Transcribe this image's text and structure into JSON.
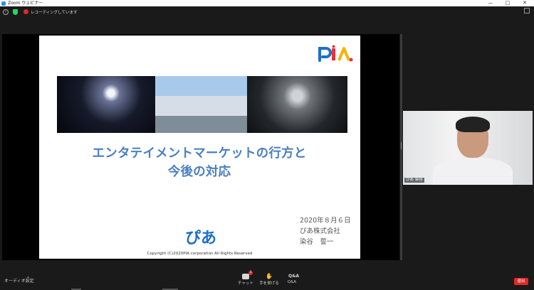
{
  "window": {
    "app_title": "Zoom ウェビナー",
    "minimize": "—",
    "maximize": "□",
    "close": "✕"
  },
  "topbar": {
    "info_icon": "i",
    "recording_text": "レコーディングしています"
  },
  "slide": {
    "title_line1": "エンタテイメントマーケットの行方と",
    "title_line2": "今後の対応",
    "date": "2020年８月６日",
    "company": "ぴあ株式会社",
    "presenter": "染谷　誓一",
    "copyright": "Copyright (C)2020PIA corporation All Rights Reserved",
    "logo_pia": "PIA",
    "logo_hira": "ぴあ"
  },
  "video": {
    "participant_name": "ぴあ 染谷"
  },
  "controls": {
    "audio_label": "オーディオ設定",
    "audio_caret": "^",
    "chat_label": "チャット",
    "chat_badge": "1",
    "raise_hand_label": "手を挙げる",
    "qa_label": "Q&A",
    "qa_icon_text": "Q&A",
    "leave_label": "退出"
  },
  "colors": {
    "title_blue": "#4a7ec2",
    "leave_red": "#e02828",
    "shield_green": "#23d959",
    "logo_red": "#e8323c",
    "logo_blue": "#1e6fc8",
    "logo_yellow": "#f5b400"
  }
}
